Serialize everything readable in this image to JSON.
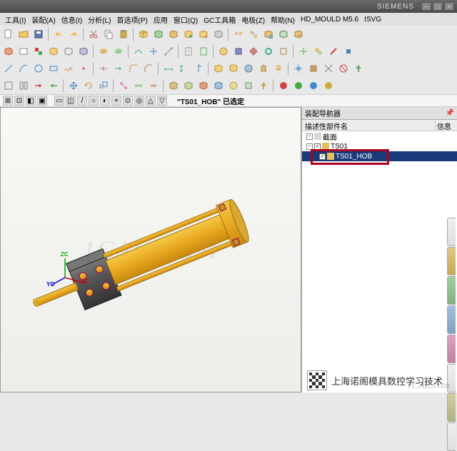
{
  "titlebar": {
    "brand": "SIEMENS"
  },
  "menus": [
    "工具(I)",
    "装配(A)",
    "信息(I)",
    "分析(L)",
    "首选项(P)",
    "应用",
    "窗口(Q)",
    "GC工具箱",
    "电极(Z)",
    "帮助(N)",
    "HD_MOULD M5.6",
    "ISVG"
  ],
  "status": {
    "text": "\"TS01_HOB\" 已选定"
  },
  "nav": {
    "title": "装配导航器",
    "col1": "描述性部件名",
    "col2": "信息",
    "tree": [
      {
        "level": 0,
        "expand": "-",
        "label": "截面"
      },
      {
        "level": 0,
        "expand": "-",
        "check": true,
        "label": "TS01"
      },
      {
        "level": 1,
        "check": true,
        "label": "TS01_HOB",
        "selected": true
      }
    ]
  },
  "triad": {
    "x": "XC",
    "y": "YC",
    "z": "ZC"
  },
  "watermark": "1CAE.COM",
  "footer": {
    "text": "上海诺阁模具数控学习技术"
  },
  "watermark2": "1CAE.com"
}
